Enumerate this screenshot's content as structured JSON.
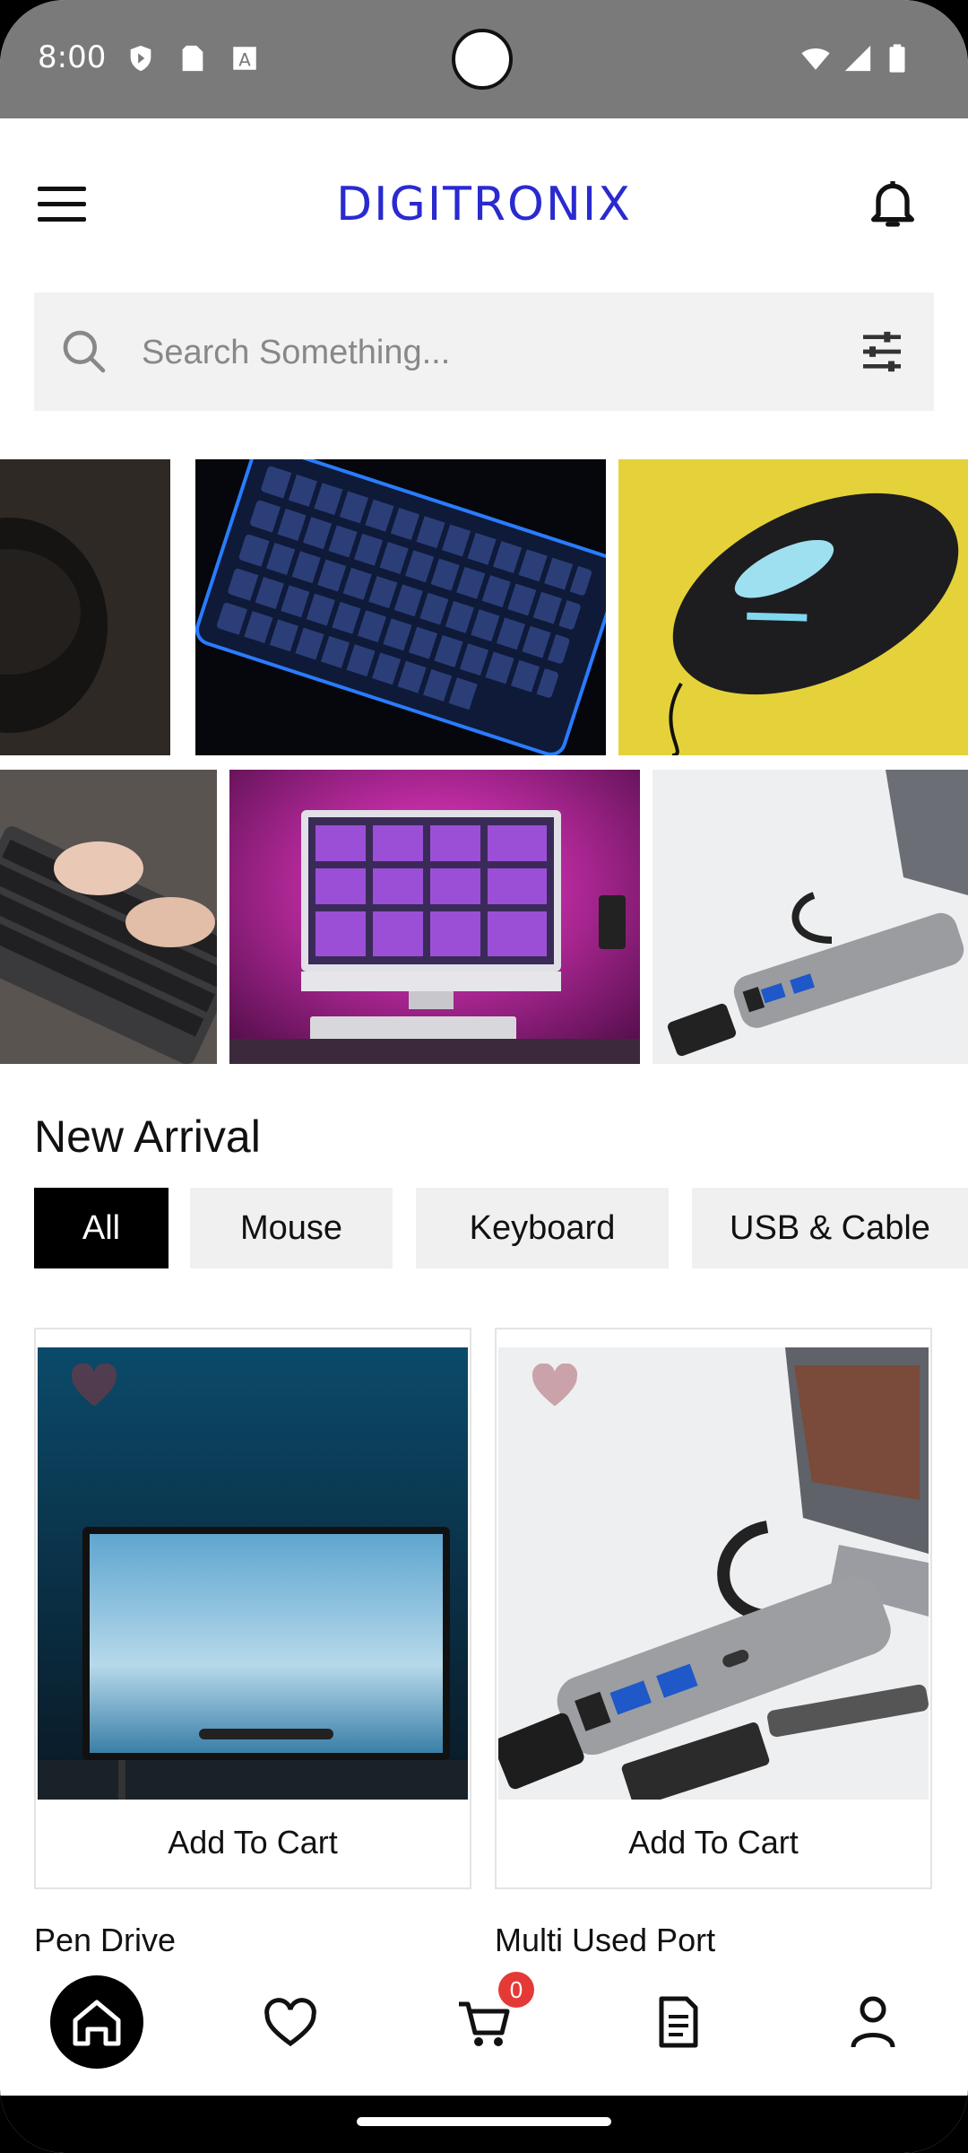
{
  "status_bar": {
    "time": "8:00"
  },
  "header": {
    "brand": "DIGITRONIX",
    "accent_color": "#2a2ad0"
  },
  "search": {
    "placeholder": "Search Something..."
  },
  "gallery": {
    "tiles": [
      "mouse-dark",
      "keyboard-blue",
      "mouse-yellow",
      "hands-keyboard",
      "imac-pink",
      "usb-hub"
    ]
  },
  "section": {
    "title": "New Arrival"
  },
  "categories": [
    {
      "label": "All",
      "active": true
    },
    {
      "label": "Mouse",
      "active": false
    },
    {
      "label": "Keyboard",
      "active": false
    },
    {
      "label": "USB & Cable",
      "active": false
    }
  ],
  "products": [
    {
      "name": "Pen Drive",
      "button": "Add To Cart",
      "image": "monitor-photo"
    },
    {
      "name": "Multi Used Port",
      "button": "Add To Cart",
      "image": "usb-hub-photo"
    }
  ],
  "bottom_nav": {
    "items": [
      "home-icon",
      "heart-icon",
      "cart-icon",
      "orders-icon",
      "profile-icon"
    ],
    "cart_count": "0"
  }
}
